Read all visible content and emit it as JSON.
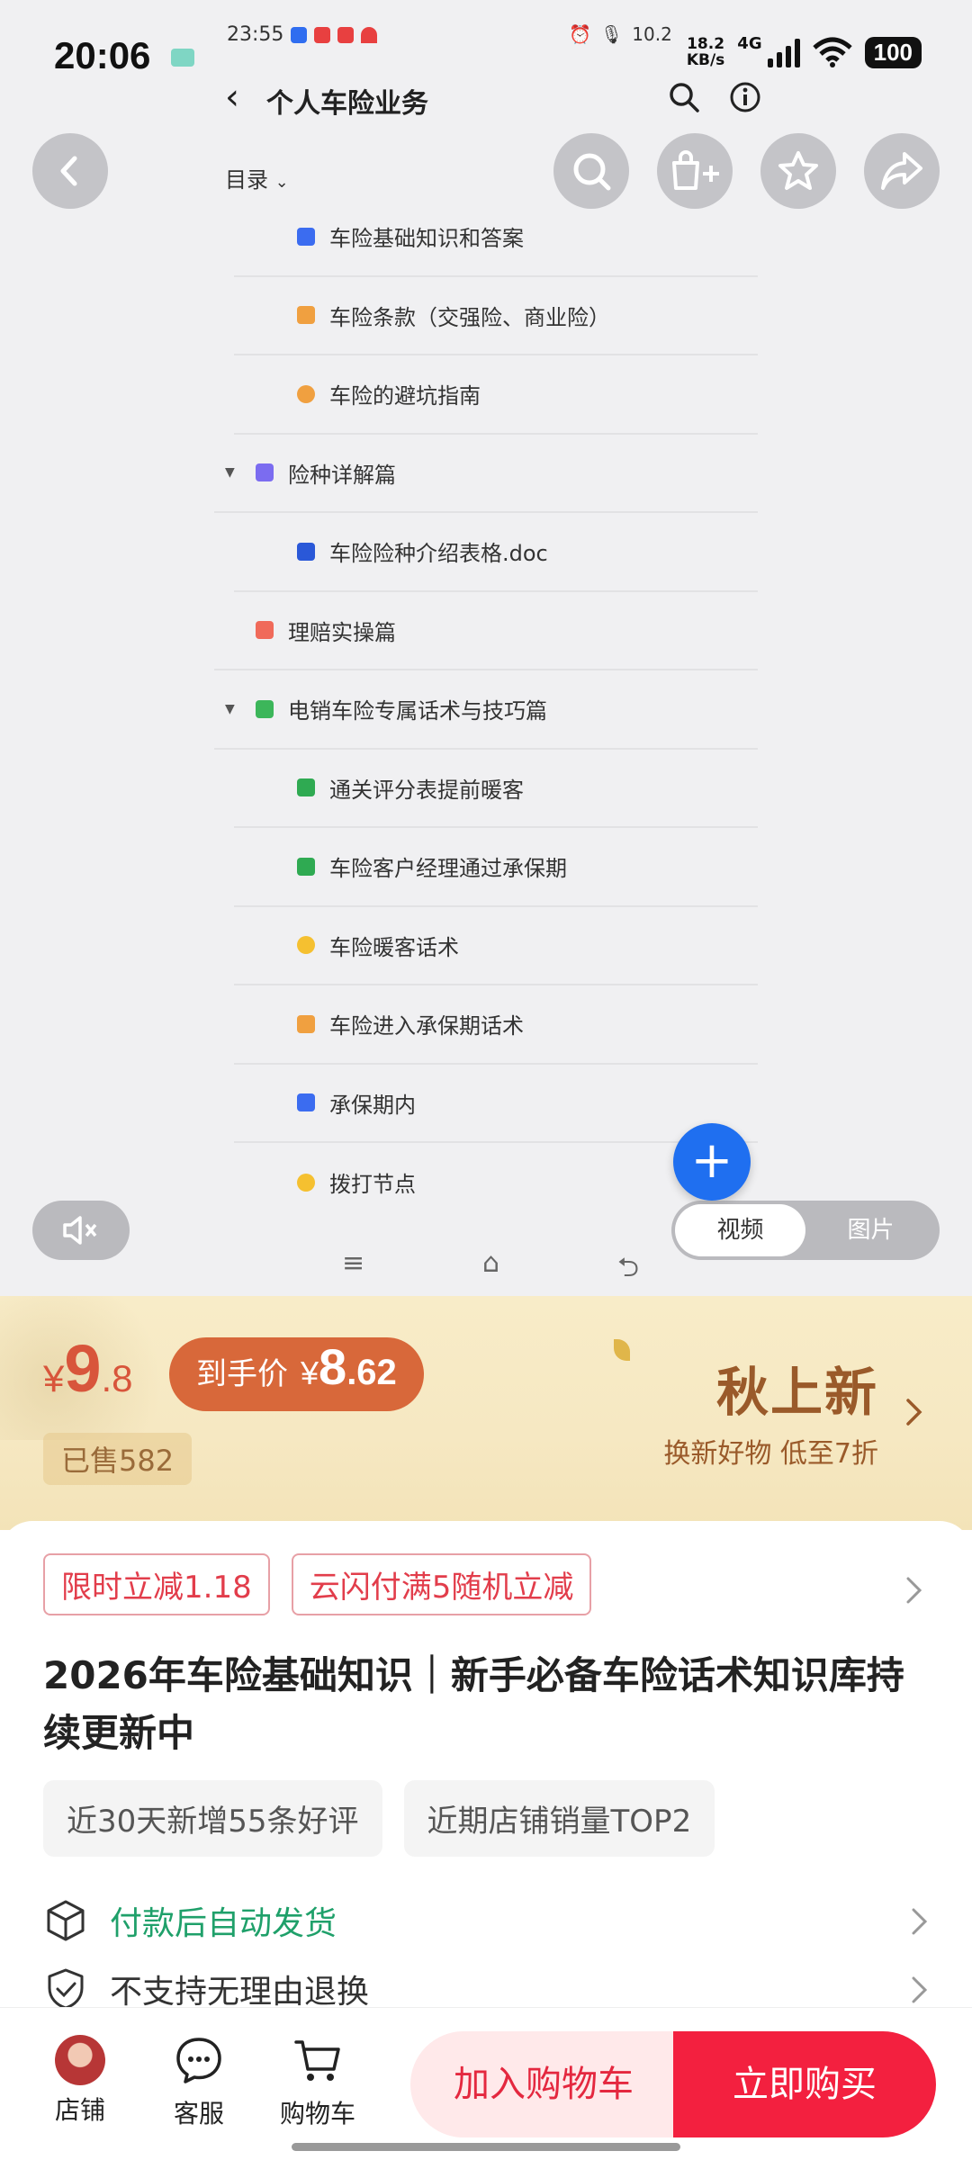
{
  "status_bar": {
    "time": "20:06",
    "speed_value": "18.2",
    "speed_unit": "KB/s",
    "network": "4G",
    "battery": "100"
  },
  "gallery": {
    "inner_status": {
      "time": "23:55",
      "speed": "10.2"
    },
    "doc_title": "个人车险业务",
    "toc_label": "目录",
    "items": [
      {
        "label": "车险基础知识和答案",
        "color": "#3b6cf0"
      },
      {
        "label": "车险条款（交强险、商业险）",
        "color": "#f0a040"
      },
      {
        "label": "车险的避坑指南",
        "color": "#f0a040"
      },
      {
        "label": "险种详解篇",
        "color": "#7b6cf0"
      },
      {
        "label": "车险险种介绍表格.doc",
        "color": "#2a58d8"
      },
      {
        "label": "理赔实操篇",
        "color": "#f06a5a"
      },
      {
        "label": "电销车险专属话术与技巧篇",
        "color": "#3cb65a"
      },
      {
        "label": "通关评分表提前暖客",
        "color": "#2faa52"
      },
      {
        "label": "车险客户经理通过承保期",
        "color": "#2faa52"
      },
      {
        "label": "车险暖客话术",
        "color": "#f5c030"
      },
      {
        "label": "车险进入承保期话术",
        "color": "#f0a040"
      },
      {
        "label": "承保期内",
        "color": "#3b6cf0"
      },
      {
        "label": "拨打节点",
        "color": "#f5c030"
      }
    ],
    "fab": "+",
    "toggle": {
      "video": "视频",
      "image": "图片"
    }
  },
  "promo": {
    "price": {
      "currency": "¥",
      "integer": "9",
      "decimal": ".8"
    },
    "net_price": {
      "label": "到手价",
      "currency": "¥",
      "integer": "8",
      "decimal": ".62"
    },
    "sold": "已售582",
    "season_title": "秋上新",
    "season_sub": "换新好物  低至7折"
  },
  "details": {
    "promo_tags": [
      "限时立减1.18",
      "云闪付满5随机立减"
    ],
    "title": "2026年车险基础知识｜新手必备车险话术知识库持续更新中",
    "badges": [
      "近30天新增55条好评",
      "近期店铺销量TOP2"
    ],
    "services": [
      {
        "label": "付款后自动发货",
        "color": "#1fa06a"
      },
      {
        "label": "不支持无理由退换",
        "color": "#333333"
      }
    ]
  },
  "action_bar": {
    "shop": "店铺",
    "service": "客服",
    "cart": "购物车",
    "add_to_cart": "加入购物车",
    "buy_now": "立即购买"
  },
  "colors": {
    "accent_red": "#f3203f",
    "price_orange": "#d8683a",
    "promo_bg": "#f6e8c2"
  }
}
